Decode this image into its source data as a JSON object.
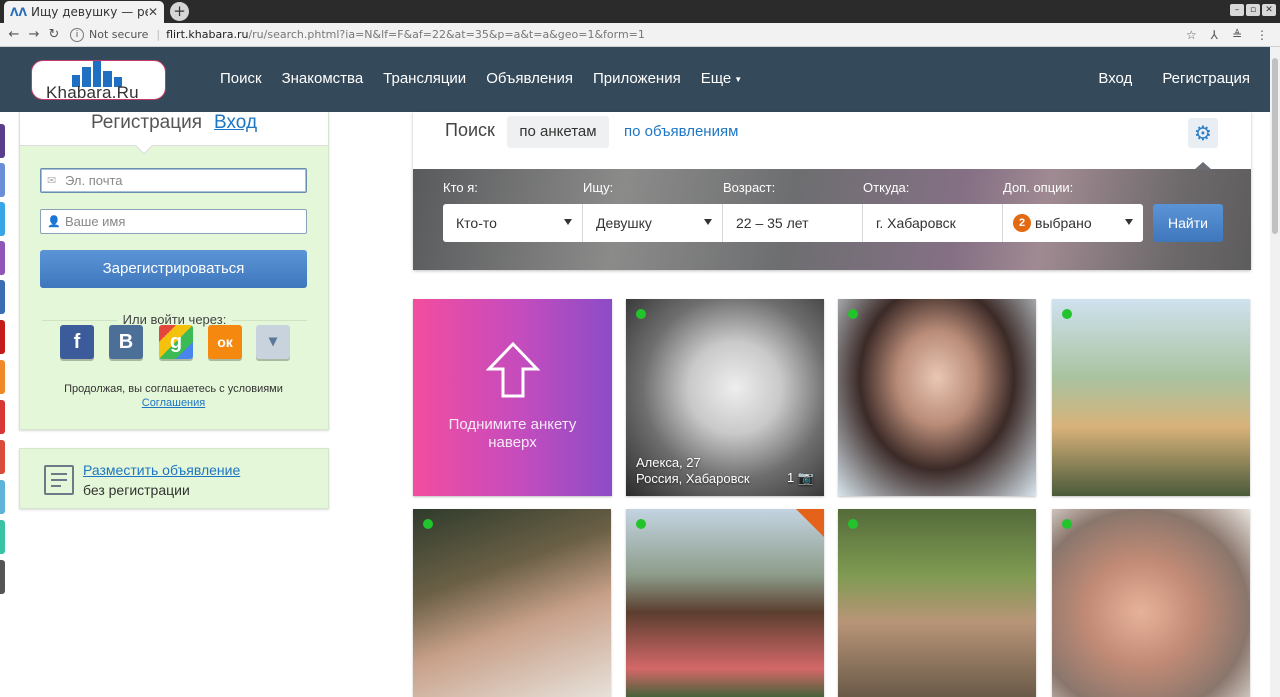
{
  "browser": {
    "tab_title": "Ищу девушку — резу",
    "tab_favicon": "ᐱᐱ",
    "tab_close": "✕",
    "new_tab": "+",
    "not_secure": "Not secure",
    "url_host": "flirt.khabara.ru",
    "url_path": "/ru/search.phtml?ia=N&lf=F&af=22&at=35&p=a&t=a&geo=1&form=1"
  },
  "header": {
    "logo_text": "Khabara.Ru",
    "nav": [
      "Поиск",
      "Знакомства",
      "Трансляции",
      "Объявления",
      "Приложения",
      "Еще"
    ],
    "login": "Вход",
    "register": "Регистрация",
    "colors": {
      "bar": "#34495a"
    }
  },
  "registration": {
    "tab_register": "Регистрация",
    "tab_login": "Вход",
    "email_placeholder": "Эл. почта",
    "name_placeholder": "Ваше имя",
    "submit": "Зарегистрироваться",
    "or_login_via": "Или войти через:",
    "social": [
      {
        "name": "facebook",
        "glyph": "f",
        "color": "#3b5b9a"
      },
      {
        "name": "vkontakte",
        "glyph": "B",
        "color": "#4c6f98"
      },
      {
        "name": "google",
        "glyph": "g",
        "color": "#d9d9d9"
      },
      {
        "name": "odnoklassniki",
        "glyph": "ок",
        "color": "#f5880e"
      },
      {
        "name": "more",
        "glyph": "▾",
        "color": "#c9d3de"
      }
    ],
    "agree_text": "Продолжая, вы соглашаетесь с условиями",
    "agree_link": "Соглашения"
  },
  "ad_box": {
    "link": "Разместить объявление",
    "sub": "без регистрации"
  },
  "search": {
    "title": "Поиск",
    "mode_active": "по анкетам",
    "mode_other": "по объявлениям",
    "settings_icon": "⚙",
    "labels": [
      "Кто я:",
      "Ищу:",
      "Возраст:",
      "Откуда:",
      "Доп. опции:"
    ],
    "who": "Кто-то",
    "seeking": "Девушку",
    "age": "22 – 35  лет",
    "location": "г. Хабаровск",
    "options_count": "2",
    "options_label": "выбрано",
    "submit": "Найти"
  },
  "promo": {
    "text": "Поднимите анкету наверх",
    "gradient": [
      "#f34d9f",
      "#8c4cc7"
    ]
  },
  "profiles": [
    {
      "name_age": "Алекса, 27",
      "location": "Россия, Хабаровск",
      "photos": "1"
    },
    {},
    {},
    {},
    {},
    {},
    {}
  ]
}
